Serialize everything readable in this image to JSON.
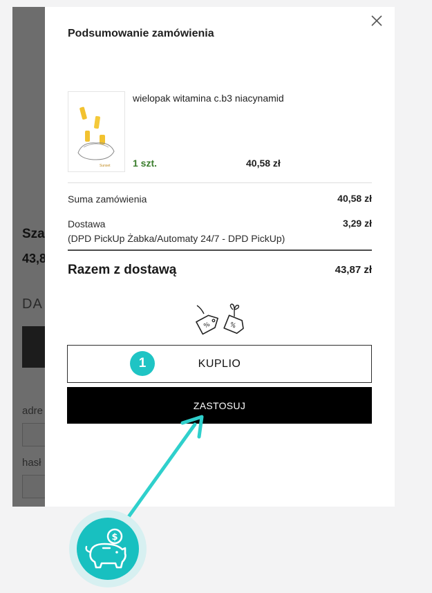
{
  "background_page": {
    "title_fragment": "Szac",
    "price_fragment": "43,8",
    "section_fragment": "DA",
    "field1_label_fragment": "adre",
    "field2_label_fragment": "hasł"
  },
  "modal": {
    "title": "Podsumowanie zamówienia",
    "close_icon": "close-icon",
    "product": {
      "name": "wielopak witamina c.b3 niacynamid",
      "quantity": "1 szt.",
      "price": "40,58 zł"
    },
    "summary": {
      "order_total_label": "Suma zamówienia",
      "order_total_value": "40,58 zł",
      "shipping_label": "Dostawa",
      "shipping_method": "(DPD PickUp Żabka/Automaty 24/7 - DPD PickUp)",
      "shipping_value": "3,29 zł",
      "grand_total_label": "Razem z dostawą",
      "grand_total_value": "43,87 zł"
    },
    "coupon": {
      "icon": "discount-tags-icon",
      "code_value": "KUPLIO",
      "apply_label": "ZASTOSUJ"
    }
  },
  "annotation": {
    "step_number": "1",
    "accent_color": "#1fc4c4",
    "logo_icon": "piggy-bank-coin-icon",
    "logo_coin_symbol": "$"
  }
}
